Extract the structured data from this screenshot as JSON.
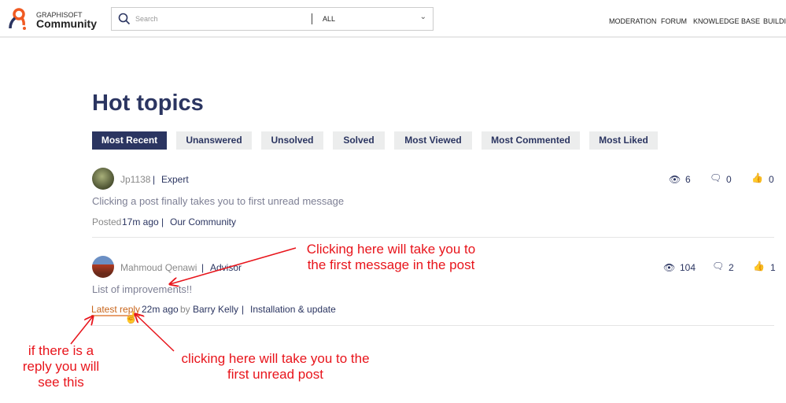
{
  "header": {
    "brand_top": "GRAPHISOFT",
    "brand_name": "Community",
    "search_placeholder": "Search",
    "scope": "ALL",
    "nav": [
      "MODERATION",
      "FORUM",
      "KNOWLEDGE BASE",
      "BUILDI"
    ]
  },
  "page_title": "Hot topics",
  "tabs": [
    "Most Recent",
    "Unanswered",
    "Unsolved",
    "Solved",
    "Most Viewed",
    "Most Commented",
    "Most Liked"
  ],
  "posts": [
    {
      "author": "Jp1138",
      "role": "Expert",
      "title": "Clicking a post finally takes you to first unread message",
      "meta_prefix": "Posted",
      "time": "17m ago",
      "board": "Our Community",
      "views": "6",
      "comments": "0",
      "likes": "0"
    },
    {
      "author": "Mahmoud Qenawi",
      "role": "Advisor",
      "title": "List of improvements!!",
      "meta_prefix": "Latest reply",
      "time": "22m ago",
      "by": "by",
      "reply_author": "Barry Kelly",
      "board": "Installation & update",
      "views": "104",
      "comments": "2",
      "likes": "1"
    }
  ],
  "annotations": {
    "a1_l1": "Clicking here will take you to",
    "a1_l2": "the first message in the post",
    "a2_l1": "if there is a",
    "a2_l2": "reply you will",
    "a2_l3": "see this",
    "a3_l1": "clicking here will take you to the",
    "a3_l2": "first unread post"
  },
  "colors": {
    "accent": "#2b3561",
    "annotation": "#e8141b",
    "reply_link": "#c8651b"
  }
}
